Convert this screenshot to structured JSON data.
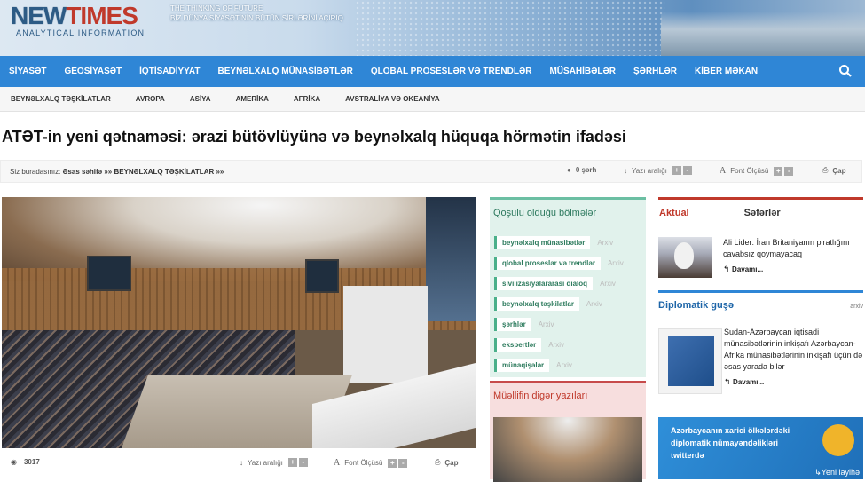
{
  "header": {
    "logo_new": "NEW",
    "logo_times": "TIMES",
    "logo_sub": "ANALYTICAL INFORMATION",
    "tagline1": "THE THINKING OF FUTURE",
    "tagline2": "BİZ DÜNYA SİYASƏTİNİN BÜTÜN SİRLƏRİNİ AÇIRIQ"
  },
  "mainnav": [
    "SİYASƏT",
    "GEOSİYASƏT",
    "İQTİSADİYYAT",
    "BEYNƏLXALQ MÜNASİBƏTLƏR",
    "QLOBAL PROSESLƏR VƏ TRENDLƏR",
    "MÜSAHİBƏLƏR",
    "ŞƏRHLƏR",
    "KİBER MƏKAN"
  ],
  "subnav": [
    "BEYNƏLXALQ TƏŞKİLATLAR",
    "AVROPA",
    "ASİYA",
    "AMERİKA",
    "AFRİKA",
    "AVSTRALİYA VƏ OKEANİYA"
  ],
  "article": {
    "title": "ATƏT-in yeni qətnaməsi: ərazi bütövlüyünə və beynəlxalq hüquqa hörmətin ifadəsi",
    "crumb_prefix": "Siz buradasınız:",
    "crumb_path": "Əsas səhifə »» BEYNƏLXALQ TƏŞKİLATLAR »»",
    "comments": "0 şərh",
    "views": "3017"
  },
  "tools": {
    "spacing": "Yazı aralığı",
    "font": "Font Ölçüsü",
    "print": "Çap",
    "plus": "+",
    "minus": "-"
  },
  "sections": {
    "header": "Qoşulu olduğu bölmələr",
    "archive": "Arxiv",
    "tags": [
      "beynəlxalq münasibətlər",
      "qlobal proseslər və trendlər",
      "sivilizasiyalararası dialoq",
      "beynəlxalq təşkilatlar",
      "şərhlər",
      "ekspertlər",
      "münaqişələr"
    ]
  },
  "other": {
    "header": "Müəllifin digər yazıları"
  },
  "sidebar": {
    "tab_aktual": "Aktual",
    "tab_seferler": "Səfərlər",
    "news1": "Ali Lider: İran Britaniyanın piratlığını cavabsız qoymayacaq",
    "more": "Davamı...",
    "dipl_header": "Diplomatik guşə",
    "dipl_archive": "arxiv",
    "news2": "Sudan-Azərbaycan iqtisadi münasibətlərinin inkişafı Azərbaycan-Afrika münasibətlərinin inkişafı üçün də əsas yarada bilər",
    "promo": "Azərbaycanın xarici ölkələrdəki diplomatik nümayəndəlikləri twitterdə",
    "promo_new": "Yeni layihə"
  }
}
